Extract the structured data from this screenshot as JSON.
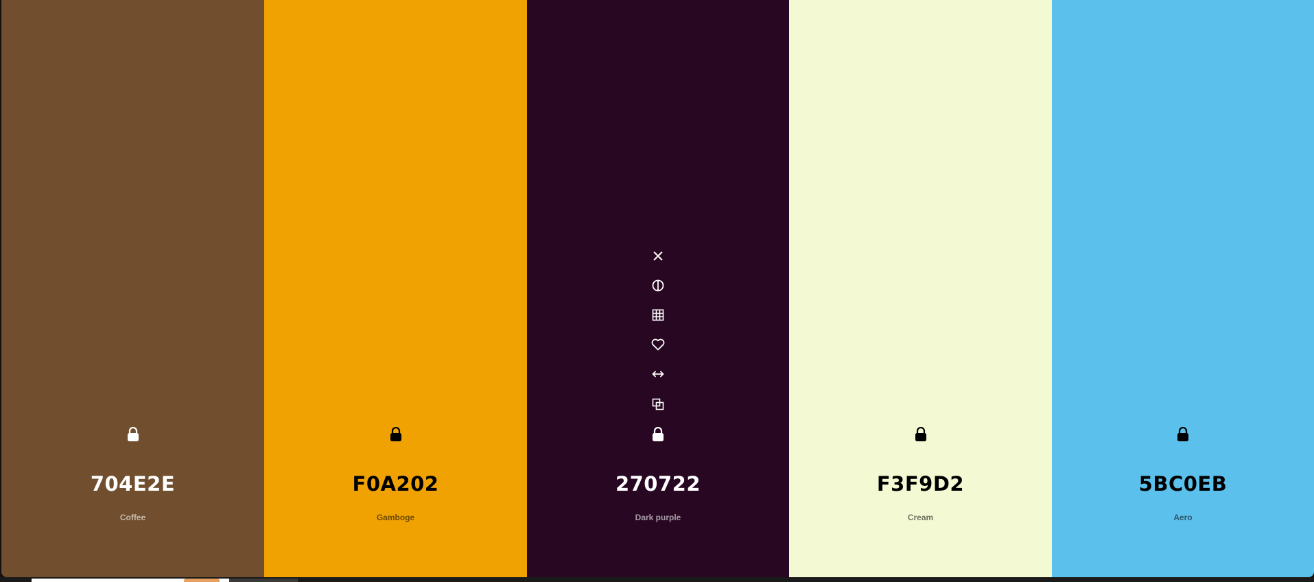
{
  "palette": {
    "swatches": [
      {
        "hex": "704E2E",
        "name": "Coffee",
        "color": "#704E2E",
        "text_tone": "light"
      },
      {
        "hex": "F0A202",
        "name": "Gamboge",
        "color": "#F0A202",
        "text_tone": "dark"
      },
      {
        "hex": "270722",
        "name": "Dark purple",
        "color": "#270722",
        "text_tone": "light"
      },
      {
        "hex": "F3F9D2",
        "name": "Cream",
        "color": "#F3F9D2",
        "text_tone": "dark"
      },
      {
        "hex": "5BC0EB",
        "name": "Aero",
        "color": "#5BC0EB",
        "text_tone": "dark"
      }
    ],
    "hovered_swatch_tools": [
      "close-icon",
      "contrast-icon",
      "shades-grid-icon",
      "heart-icon",
      "drag-arrows-icon",
      "copy-icon",
      "lock-icon"
    ]
  }
}
